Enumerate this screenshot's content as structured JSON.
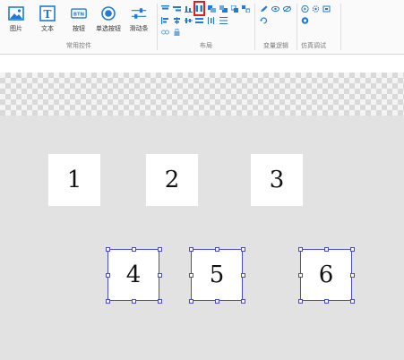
{
  "toolbar": {
    "widgets": [
      {
        "label": "图片",
        "icon": "image-icon"
      },
      {
        "label": "文本",
        "icon": "text-icon"
      },
      {
        "label": "按钮",
        "icon": "button-icon",
        "icon_text": "BTN"
      },
      {
        "label": "单选按钮",
        "icon": "radio-icon"
      },
      {
        "label": "滑动条",
        "icon": "slider-icon"
      }
    ],
    "groups": {
      "common_controls": "常用控件",
      "layout": "布局",
      "variable_logic": "变量逻辑",
      "simulation_debug": "仿真调试"
    },
    "icon_text_T": "T"
  },
  "canvas": {
    "boxes": [
      {
        "label": "1",
        "selected": false
      },
      {
        "label": "2",
        "selected": false
      },
      {
        "label": "3",
        "selected": false
      },
      {
        "label": "4",
        "selected": true
      },
      {
        "label": "5",
        "selected": true
      },
      {
        "label": "6",
        "selected": true
      }
    ]
  },
  "colors": {
    "accent": "#1f7bd6",
    "selection": "#4a4ad0",
    "highlight": "#e02020",
    "canvas_bg": "#e2e2e2"
  }
}
